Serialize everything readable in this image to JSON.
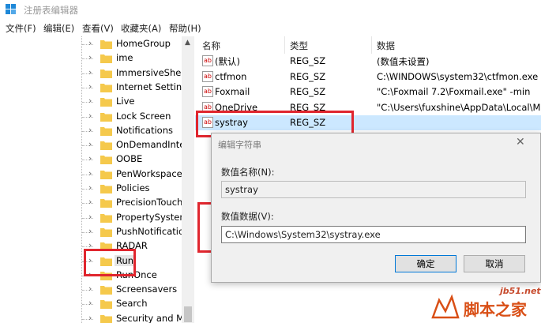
{
  "window": {
    "title": "注册表编辑器"
  },
  "menu": [
    "文件(F)",
    "编辑(E)",
    "查看(V)",
    "收藏夹(A)",
    "帮助(H)"
  ],
  "tree": {
    "items": [
      "HomeGroup",
      "ime",
      "ImmersiveShell",
      "Internet Setting",
      "Live",
      "Lock Screen",
      "Notifications",
      "OnDemandInte",
      "OOBE",
      "PenWorkspace",
      "Policies",
      "PrecisionTouch",
      "PropertySystem",
      "PushNotification",
      "RADAR",
      "Run",
      "RunOnce",
      "Screensavers",
      "Search",
      "Security and Ma"
    ],
    "selected": "Run"
  },
  "list": {
    "columns": {
      "name": "名称",
      "type": "类型",
      "data": "数据"
    },
    "rows": [
      {
        "name": "(默认)",
        "type": "REG_SZ",
        "data": "(数值未设置)"
      },
      {
        "name": "ctfmon",
        "type": "REG_SZ",
        "data": "C:\\WINDOWS\\system32\\ctfmon.exe"
      },
      {
        "name": "Foxmail",
        "type": "REG_SZ",
        "data": "\"C:\\Foxmail 7.2\\Foxmail.exe\" -min"
      },
      {
        "name": "OneDrive",
        "type": "REG_SZ",
        "data": "\"C:\\Users\\fuxshine\\AppData\\Local\\Micr"
      },
      {
        "name": "systray",
        "type": "REG_SZ",
        "data": ""
      }
    ],
    "icon_label": "ab"
  },
  "dialog": {
    "title": "编辑字符串",
    "name_label": "数值名称(N):",
    "name_value": "systray",
    "data_label": "数值数据(V):",
    "data_value": "C:\\Windows\\System32\\systray.exe",
    "ok": "确定",
    "cancel": "取消"
  },
  "watermark": {
    "url": "jb51.net",
    "name": "脚本之家"
  },
  "colors": {
    "highlight_box": "#e0262e",
    "selection": "#cce8ff",
    "folder": "#f5c94c"
  }
}
